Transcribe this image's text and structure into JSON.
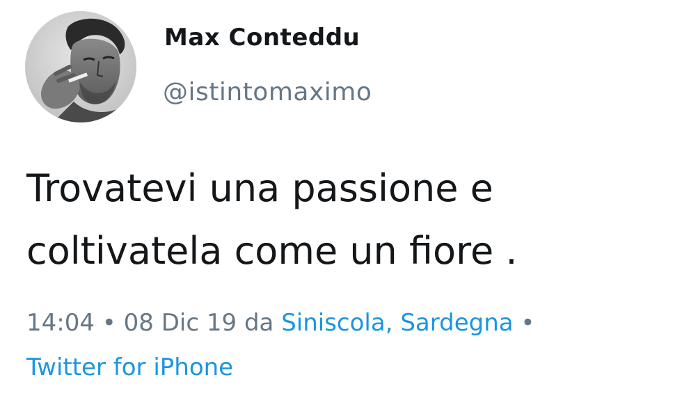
{
  "tweet": {
    "author": {
      "name": "Max Conteddu",
      "handle": "@istintomaximo"
    },
    "text_lines": [
      "Trovatevi una passione e",
      "coltivatela come un fiore ."
    ],
    "meta": {
      "time": "14:04",
      "separator": "•",
      "date": "08 Dic 19",
      "from_label": "da",
      "location": "Siniscola, Sardegna",
      "source": "Twitter for iPhone"
    }
  },
  "colors": {
    "text": "#14171a",
    "muted": "#657786",
    "link": "#1b95e0",
    "background": "#ffffff"
  },
  "icons": {
    "avatar": "profile-photo-man-smoking"
  }
}
